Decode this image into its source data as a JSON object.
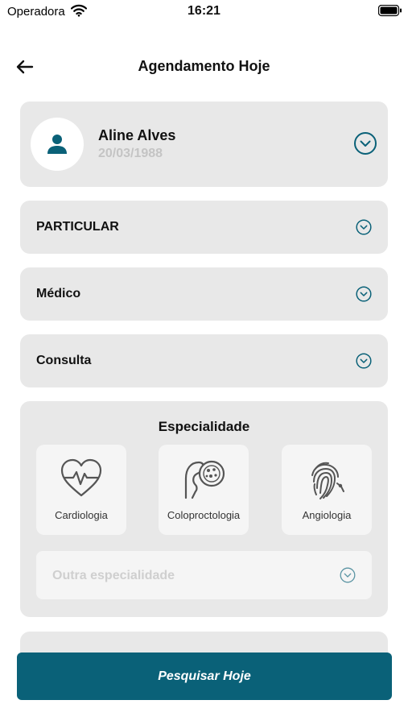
{
  "status_bar": {
    "carrier": "Operadora",
    "time": "16:21"
  },
  "header": {
    "title": "Agendamento Hoje"
  },
  "patient": {
    "name": "Aline Alves",
    "dob": "20/03/1988"
  },
  "selects": {
    "plano": "PARTICULAR",
    "profissional": "Médico",
    "tipo": "Consulta"
  },
  "especialidade": {
    "title": "Especialidade",
    "tiles": [
      {
        "label": "Cardiologia",
        "icon": "heart-pulse-icon"
      },
      {
        "label": "Coloproctologia",
        "icon": "colon-cells-icon"
      },
      {
        "label": "Angiologia",
        "icon": "fingerprint-icon"
      }
    ],
    "other_placeholder": "Outra especialidade"
  },
  "partial_card": {
    "label": ""
  },
  "search_button": {
    "label": "Pesquisar Hoje"
  },
  "colors": {
    "accent": "#0a6178",
    "card_bg": "#e8e8e8",
    "tile_bg": "#f5f5f5",
    "muted_text": "#c4c4c4"
  }
}
